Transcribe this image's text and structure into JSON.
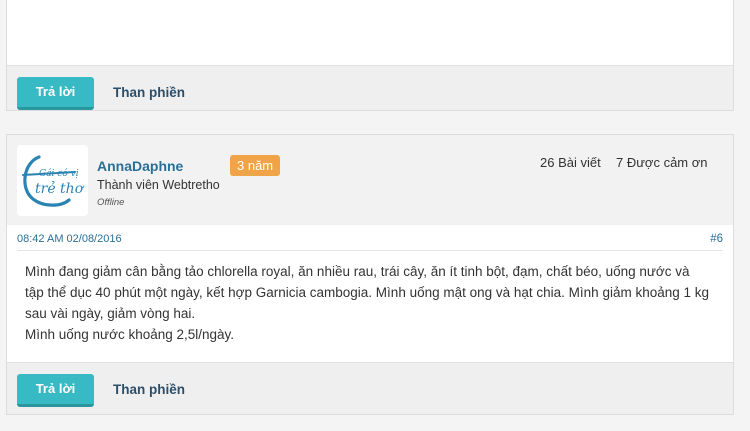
{
  "top_post": {
    "reply_label": "Trả lời",
    "complain_label": "Than phiền"
  },
  "post": {
    "avatar": {
      "line1": "Gái có vị",
      "line2": "trẻ thơ"
    },
    "username": "AnnaDaphne",
    "badge": "3 năm",
    "member_title": "Thành viên Webtretho",
    "status": "Offline",
    "posts_count": "26 Bài viết",
    "thanks_count": "7 Được cảm ơn",
    "timestamp": "08:42 AM 02/08/2016",
    "post_number": "#6",
    "body": [
      "Mình đang giảm cân bằng tảo chlorella royal, ăn nhiều rau, trái cây, ăn ít tinh bột, đạm, chất béo, uống nước và tập thể dục 40 phút một ngày, kết hợp Garnicia cambogia. Mình uống mật ong và hạt chia. Mình giảm khoảng 1 kg sau vài ngày, giảm vòng hai.",
      "Mình uống nước khoảng 2,5l/ngày."
    ],
    "reply_label": "Trả lời",
    "complain_label": "Than phiền"
  },
  "colors": {
    "accent": "#37bac3",
    "badge": "#f0a347",
    "link": "#2b6f97"
  }
}
